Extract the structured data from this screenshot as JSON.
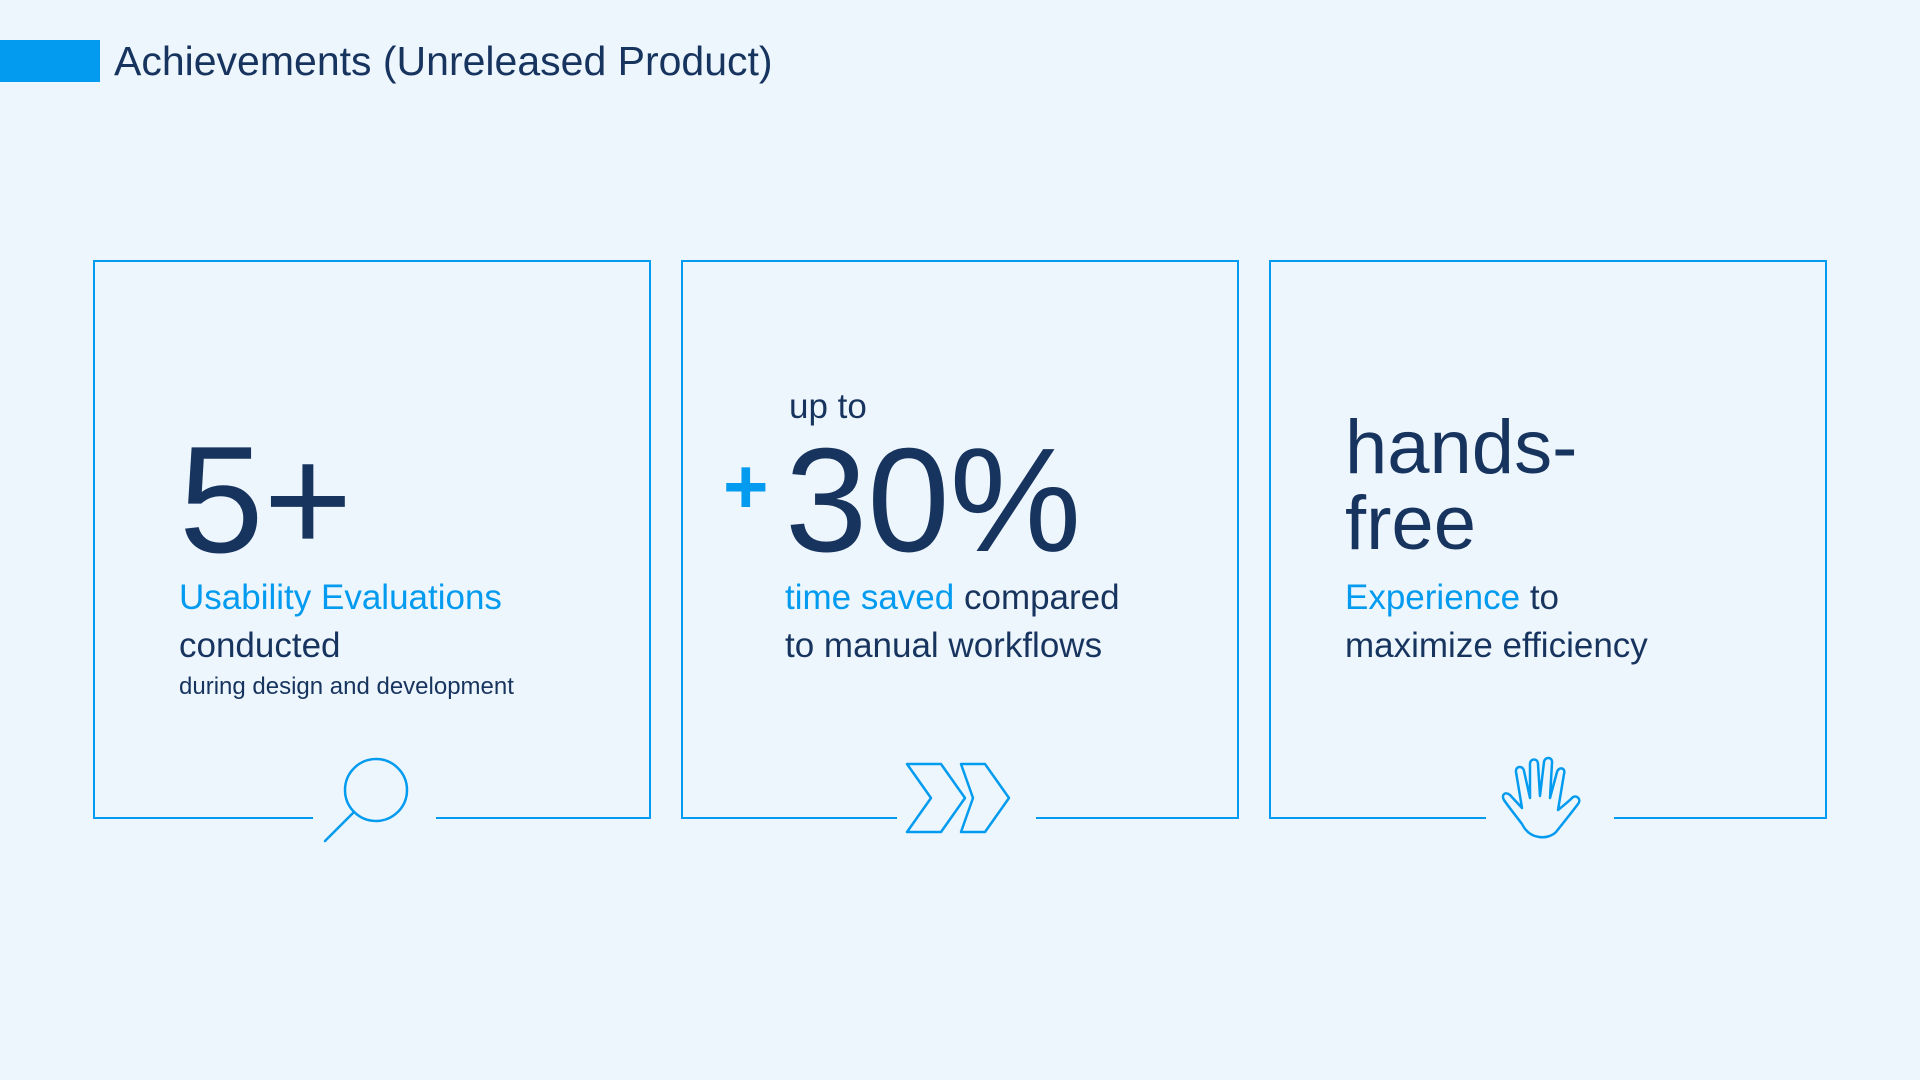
{
  "header": {
    "title": "Achievements (Unreleased Product)"
  },
  "colors": {
    "background": "#eef6fd",
    "accent": "#039bef",
    "text": "#17345f"
  },
  "cards": [
    {
      "headline": "5+",
      "desc_highlight": "Usability Evaluations",
      "desc_rest": "conducted",
      "sub": "during design and development",
      "icon": "magnifier-icon"
    },
    {
      "prefix": "up to",
      "plus": "+",
      "headline": "30%",
      "desc_highlight": "time saved",
      "desc_rest_1": " compared",
      "desc_rest_2": "to manual workflows",
      "icon": "double-chevron-icon"
    },
    {
      "headline_1": "hands-",
      "headline_2": "free",
      "desc_highlight": "Experience",
      "desc_rest_1": " to",
      "desc_rest_2": "maximize efficiency",
      "icon": "hand-icon"
    }
  ]
}
